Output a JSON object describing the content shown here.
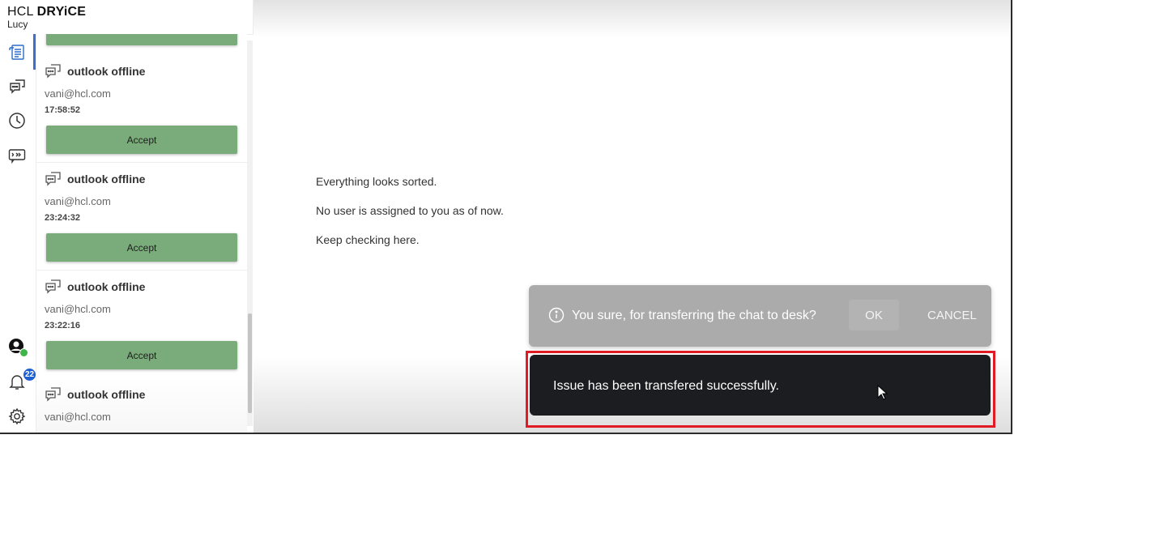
{
  "brand": {
    "logo_part1": "HCL",
    "logo_part2": "DRYiCE",
    "subtitle": "Lucy"
  },
  "rail": {
    "notification_count": "22"
  },
  "chats": [
    {
      "title": "outlook offline",
      "email": "vani@hcl.com",
      "time": "17:58:52",
      "accept_label": "Accept"
    },
    {
      "title": "outlook offline",
      "email": "vani@hcl.com",
      "time": "23:24:32",
      "accept_label": "Accept"
    },
    {
      "title": "outlook offline",
      "email": "vani@hcl.com",
      "time": "23:22:16",
      "accept_label": "Accept"
    },
    {
      "title": "outlook offline",
      "email": "vani@hcl.com"
    }
  ],
  "main": {
    "messages": [
      "Everything looks sorted.",
      "No user is assigned to you as of now.",
      "Keep checking here."
    ]
  },
  "confirm": {
    "question": "You sure, for transferring the chat to desk?",
    "ok_label": "OK",
    "cancel_label": "CANCEL"
  },
  "toast": {
    "text": "Issue has been transfered successfully."
  },
  "colors": {
    "accept_green": "#7aab7a",
    "toast_bg": "#1c1d21",
    "highlight_red": "#e01b24",
    "active_blue": "#3b72c7"
  }
}
